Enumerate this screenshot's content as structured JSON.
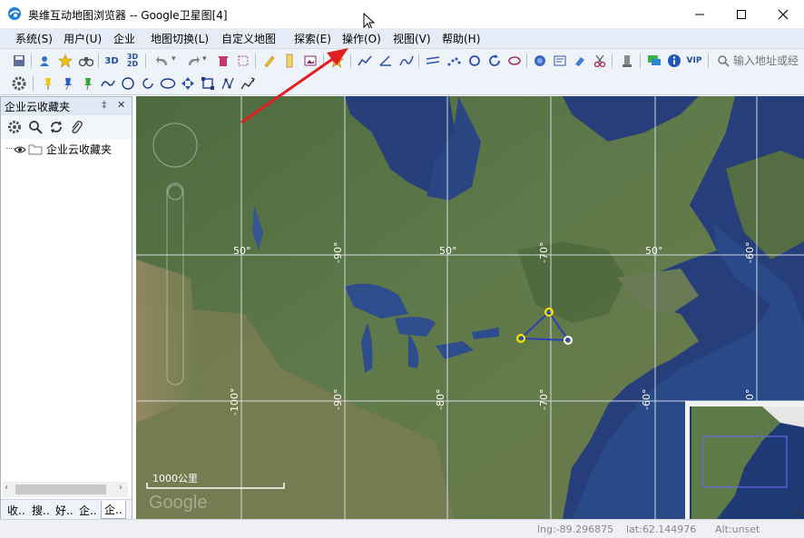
{
  "window": {
    "title": "奥维互动地图浏览器 -- Google卫星图[4]",
    "app_icon": "globe-app-icon",
    "controls": [
      "minimize-icon",
      "maximize-icon",
      "close-icon"
    ]
  },
  "menu": [
    {
      "label": "系统(S)"
    },
    {
      "label": "用户(U)"
    },
    {
      "label": "企业"
    },
    {
      "label": "地图切换(L)"
    },
    {
      "label": "自定义地图"
    },
    {
      "label": "探索(E)"
    },
    {
      "label": "操作(O)"
    },
    {
      "label": "视图(V)"
    },
    {
      "label": "帮助(H)"
    }
  ],
  "toolbar": {
    "btn_3d": "3D",
    "btn_3d2d_top": "3D",
    "btn_3d2d_bottom": "2D",
    "vip": "VIP",
    "address_placeholder": "输入地址或经",
    "icons": [
      "save-icon",
      "user-icon",
      "favorite-star-icon",
      "binoculars-icon",
      "undo-icon",
      "redo-icon",
      "delete-icon",
      "select-box-icon",
      "pencil-icon",
      "ruler-icon",
      "image-icon",
      "bookmark-star-icon",
      "track-icon",
      "angle-icon",
      "path-icon",
      "parallel-icon",
      "dots-icon",
      "rotate-icon",
      "refresh-icon",
      "lasso-icon",
      "globe-icon",
      "map-icon",
      "eraser-icon",
      "scissors-icon",
      "landmark-icon",
      "chat-icon",
      "info-icon",
      "search-icon"
    ],
    "draw_icons": [
      "settings-icon",
      "pin-yellow-icon",
      "pin-blue-icon",
      "pin-green-icon",
      "polyline-icon",
      "circle-icon",
      "arc-icon",
      "ellipse-icon",
      "move-icon",
      "rectangle-icon",
      "node-edit-icon",
      "line-chart-icon"
    ]
  },
  "sidebar": {
    "title": "企业云收藏夹",
    "pin_glyph": "‡",
    "close_glyph": "✕",
    "tools": [
      "gear-icon",
      "magnifier-icon",
      "sync-icon",
      "paperclip-icon"
    ],
    "tree_item": "企业云收藏夹",
    "tabs": [
      "收..",
      "搜..",
      "好..",
      "企..",
      "企.."
    ]
  },
  "map": {
    "grid_lat_labels": [
      "50°",
      "50°",
      "50°"
    ],
    "grid_lon_labels_top": [
      "-90°",
      "-70°",
      "-60°"
    ],
    "grid_lon_labels_bottom": [
      "-100°",
      "-90°",
      "-80°",
      "-70°",
      "-60°",
      "-50°"
    ],
    "scale_label": "1000公里",
    "watermark": "Google"
  },
  "status": {
    "lng": "lng:-89.296875",
    "lat": "lat:62.144976",
    "alt": "Alt:unset"
  },
  "colors": {
    "menubar": "#e5ecf7",
    "toolbar": "#eef2f9",
    "arrow": "#e02020",
    "ocean": "#243c78",
    "triangle": "#2b3fb8",
    "point_yellow": "#ffe800"
  }
}
